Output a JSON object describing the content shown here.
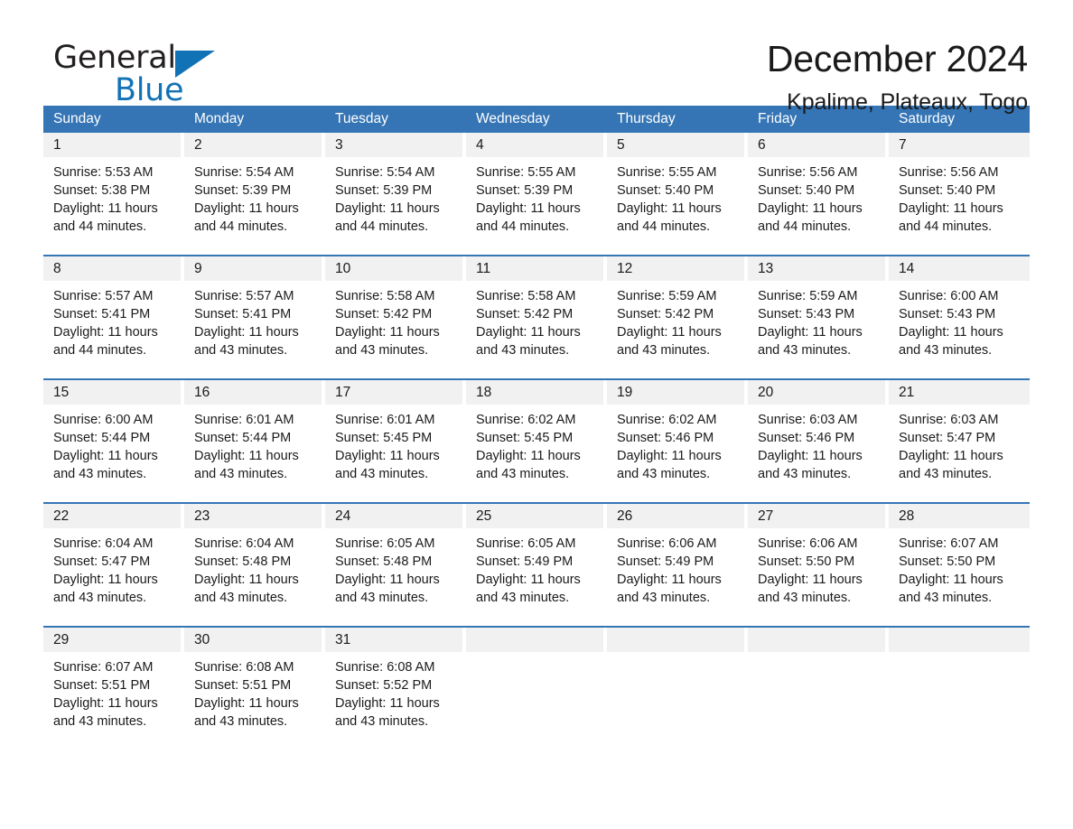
{
  "logo": {
    "word1": "General",
    "word2": "Blue",
    "triangle_color": "#1272b6"
  },
  "header": {
    "month_title": "December 2024",
    "location": "Kpalime, Plateaux, Togo"
  },
  "colors": {
    "header_blue": "#3575b5",
    "date_band_gray": "#f1f1f1",
    "text": "#1a1a1a"
  },
  "weekdays": [
    "Sunday",
    "Monday",
    "Tuesday",
    "Wednesday",
    "Thursday",
    "Friday",
    "Saturday"
  ],
  "weeks": [
    [
      {
        "date": "1",
        "sunrise": "Sunrise: 5:53 AM",
        "sunset": "Sunset: 5:38 PM",
        "daylight_1": "Daylight: 11 hours",
        "daylight_2": "and 44 minutes."
      },
      {
        "date": "2",
        "sunrise": "Sunrise: 5:54 AM",
        "sunset": "Sunset: 5:39 PM",
        "daylight_1": "Daylight: 11 hours",
        "daylight_2": "and 44 minutes."
      },
      {
        "date": "3",
        "sunrise": "Sunrise: 5:54 AM",
        "sunset": "Sunset: 5:39 PM",
        "daylight_1": "Daylight: 11 hours",
        "daylight_2": "and 44 minutes."
      },
      {
        "date": "4",
        "sunrise": "Sunrise: 5:55 AM",
        "sunset": "Sunset: 5:39 PM",
        "daylight_1": "Daylight: 11 hours",
        "daylight_2": "and 44 minutes."
      },
      {
        "date": "5",
        "sunrise": "Sunrise: 5:55 AM",
        "sunset": "Sunset: 5:40 PM",
        "daylight_1": "Daylight: 11 hours",
        "daylight_2": "and 44 minutes."
      },
      {
        "date": "6",
        "sunrise": "Sunrise: 5:56 AM",
        "sunset": "Sunset: 5:40 PM",
        "daylight_1": "Daylight: 11 hours",
        "daylight_2": "and 44 minutes."
      },
      {
        "date": "7",
        "sunrise": "Sunrise: 5:56 AM",
        "sunset": "Sunset: 5:40 PM",
        "daylight_1": "Daylight: 11 hours",
        "daylight_2": "and 44 minutes."
      }
    ],
    [
      {
        "date": "8",
        "sunrise": "Sunrise: 5:57 AM",
        "sunset": "Sunset: 5:41 PM",
        "daylight_1": "Daylight: 11 hours",
        "daylight_2": "and 44 minutes."
      },
      {
        "date": "9",
        "sunrise": "Sunrise: 5:57 AM",
        "sunset": "Sunset: 5:41 PM",
        "daylight_1": "Daylight: 11 hours",
        "daylight_2": "and 43 minutes."
      },
      {
        "date": "10",
        "sunrise": "Sunrise: 5:58 AM",
        "sunset": "Sunset: 5:42 PM",
        "daylight_1": "Daylight: 11 hours",
        "daylight_2": "and 43 minutes."
      },
      {
        "date": "11",
        "sunrise": "Sunrise: 5:58 AM",
        "sunset": "Sunset: 5:42 PM",
        "daylight_1": "Daylight: 11 hours",
        "daylight_2": "and 43 minutes."
      },
      {
        "date": "12",
        "sunrise": "Sunrise: 5:59 AM",
        "sunset": "Sunset: 5:42 PM",
        "daylight_1": "Daylight: 11 hours",
        "daylight_2": "and 43 minutes."
      },
      {
        "date": "13",
        "sunrise": "Sunrise: 5:59 AM",
        "sunset": "Sunset: 5:43 PM",
        "daylight_1": "Daylight: 11 hours",
        "daylight_2": "and 43 minutes."
      },
      {
        "date": "14",
        "sunrise": "Sunrise: 6:00 AM",
        "sunset": "Sunset: 5:43 PM",
        "daylight_1": "Daylight: 11 hours",
        "daylight_2": "and 43 minutes."
      }
    ],
    [
      {
        "date": "15",
        "sunrise": "Sunrise: 6:00 AM",
        "sunset": "Sunset: 5:44 PM",
        "daylight_1": "Daylight: 11 hours",
        "daylight_2": "and 43 minutes."
      },
      {
        "date": "16",
        "sunrise": "Sunrise: 6:01 AM",
        "sunset": "Sunset: 5:44 PM",
        "daylight_1": "Daylight: 11 hours",
        "daylight_2": "and 43 minutes."
      },
      {
        "date": "17",
        "sunrise": "Sunrise: 6:01 AM",
        "sunset": "Sunset: 5:45 PM",
        "daylight_1": "Daylight: 11 hours",
        "daylight_2": "and 43 minutes."
      },
      {
        "date": "18",
        "sunrise": "Sunrise: 6:02 AM",
        "sunset": "Sunset: 5:45 PM",
        "daylight_1": "Daylight: 11 hours",
        "daylight_2": "and 43 minutes."
      },
      {
        "date": "19",
        "sunrise": "Sunrise: 6:02 AM",
        "sunset": "Sunset: 5:46 PM",
        "daylight_1": "Daylight: 11 hours",
        "daylight_2": "and 43 minutes."
      },
      {
        "date": "20",
        "sunrise": "Sunrise: 6:03 AM",
        "sunset": "Sunset: 5:46 PM",
        "daylight_1": "Daylight: 11 hours",
        "daylight_2": "and 43 minutes."
      },
      {
        "date": "21",
        "sunrise": "Sunrise: 6:03 AM",
        "sunset": "Sunset: 5:47 PM",
        "daylight_1": "Daylight: 11 hours",
        "daylight_2": "and 43 minutes."
      }
    ],
    [
      {
        "date": "22",
        "sunrise": "Sunrise: 6:04 AM",
        "sunset": "Sunset: 5:47 PM",
        "daylight_1": "Daylight: 11 hours",
        "daylight_2": "and 43 minutes."
      },
      {
        "date": "23",
        "sunrise": "Sunrise: 6:04 AM",
        "sunset": "Sunset: 5:48 PM",
        "daylight_1": "Daylight: 11 hours",
        "daylight_2": "and 43 minutes."
      },
      {
        "date": "24",
        "sunrise": "Sunrise: 6:05 AM",
        "sunset": "Sunset: 5:48 PM",
        "daylight_1": "Daylight: 11 hours",
        "daylight_2": "and 43 minutes."
      },
      {
        "date": "25",
        "sunrise": "Sunrise: 6:05 AM",
        "sunset": "Sunset: 5:49 PM",
        "daylight_1": "Daylight: 11 hours",
        "daylight_2": "and 43 minutes."
      },
      {
        "date": "26",
        "sunrise": "Sunrise: 6:06 AM",
        "sunset": "Sunset: 5:49 PM",
        "daylight_1": "Daylight: 11 hours",
        "daylight_2": "and 43 minutes."
      },
      {
        "date": "27",
        "sunrise": "Sunrise: 6:06 AM",
        "sunset": "Sunset: 5:50 PM",
        "daylight_1": "Daylight: 11 hours",
        "daylight_2": "and 43 minutes."
      },
      {
        "date": "28",
        "sunrise": "Sunrise: 6:07 AM",
        "sunset": "Sunset: 5:50 PM",
        "daylight_1": "Daylight: 11 hours",
        "daylight_2": "and 43 minutes."
      }
    ],
    [
      {
        "date": "29",
        "sunrise": "Sunrise: 6:07 AM",
        "sunset": "Sunset: 5:51 PM",
        "daylight_1": "Daylight: 11 hours",
        "daylight_2": "and 43 minutes."
      },
      {
        "date": "30",
        "sunrise": "Sunrise: 6:08 AM",
        "sunset": "Sunset: 5:51 PM",
        "daylight_1": "Daylight: 11 hours",
        "daylight_2": "and 43 minutes."
      },
      {
        "date": "31",
        "sunrise": "Sunrise: 6:08 AM",
        "sunset": "Sunset: 5:52 PM",
        "daylight_1": "Daylight: 11 hours",
        "daylight_2": "and 43 minutes."
      },
      {
        "date": "",
        "sunrise": "",
        "sunset": "",
        "daylight_1": "",
        "daylight_2": ""
      },
      {
        "date": "",
        "sunrise": "",
        "sunset": "",
        "daylight_1": "",
        "daylight_2": ""
      },
      {
        "date": "",
        "sunrise": "",
        "sunset": "",
        "daylight_1": "",
        "daylight_2": ""
      },
      {
        "date": "",
        "sunrise": "",
        "sunset": "",
        "daylight_1": "",
        "daylight_2": ""
      }
    ]
  ]
}
